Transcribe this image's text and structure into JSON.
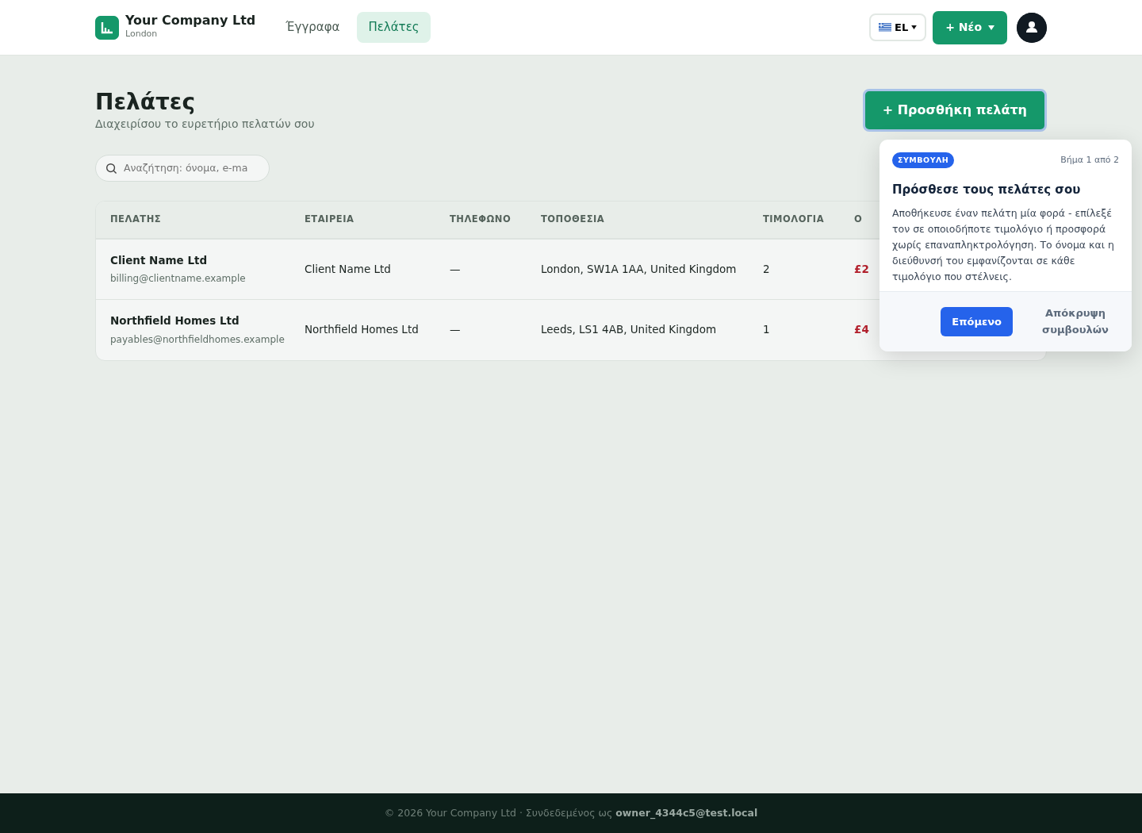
{
  "brand": {
    "name": "Your Company Ltd",
    "location": "London"
  },
  "nav": [
    {
      "label": "Έγγραφα",
      "selected": false
    },
    {
      "label": "Πελάτες",
      "selected": true
    }
  ],
  "language": {
    "code": "EL"
  },
  "new_button": {
    "label": "+ Νέο"
  },
  "page": {
    "title": "Πελάτες",
    "subtitle": "Διαχειρίσου το ευρετήριο πελατών σου",
    "add_button": "+ Προσθήκη πελάτη"
  },
  "search": {
    "placeholder": "Αναζήτηση: όνομα, e-ma"
  },
  "table": {
    "columns": [
      "ΠΕΛΑΤΗΣ",
      "ΕΤΑΙΡΕΙΑ",
      "ΤΗΛΕΦΩΝΟ",
      "ΤΟΠΟΘΕΣΙΑ",
      "ΤΙΜΟΛΟΓΙΑ",
      "Ο"
    ],
    "rows": [
      {
        "name": "Client Name Ltd",
        "email": "billing@clientname.example",
        "company": "Client Name Ltd",
        "phone": "—",
        "location": "London, SW1A 1AA, United Kingdom",
        "invoices": "2",
        "column_6": "£2"
      },
      {
        "name": "Northfield Homes Ltd",
        "email": "payables@northfieldhomes.example",
        "company": "Northfield Homes Ltd",
        "phone": "—",
        "location": "Leeds, LS1 4AB, United Kingdom",
        "invoices": "1",
        "column_6": "£4"
      }
    ]
  },
  "tip": {
    "badge": "ΣΥΜΒΟΥΛΗ",
    "step": "Βήμα 1 από 2",
    "title": "Πρόσθεσε τους πελάτες σου",
    "body": "Αποθήκευσε έναν πελάτη μία φορά - επίλεξέ τον σε οποιοδήποτε τιμολόγιο ή προσφορά χωρίς επαναπληκτρολόγηση. Το όνομα και η διεύθυνσή του εμφανίζονται σε κάθε τιμολόγιο που στέλνεις.",
    "next": "Επόμενο",
    "hide": "Απόκρυψη συμβουλών"
  },
  "footer": {
    "text": "© 2026 Your Company Ltd · Συνδεδεμένος ως",
    "user": "owner_4344c5@test.local"
  }
}
